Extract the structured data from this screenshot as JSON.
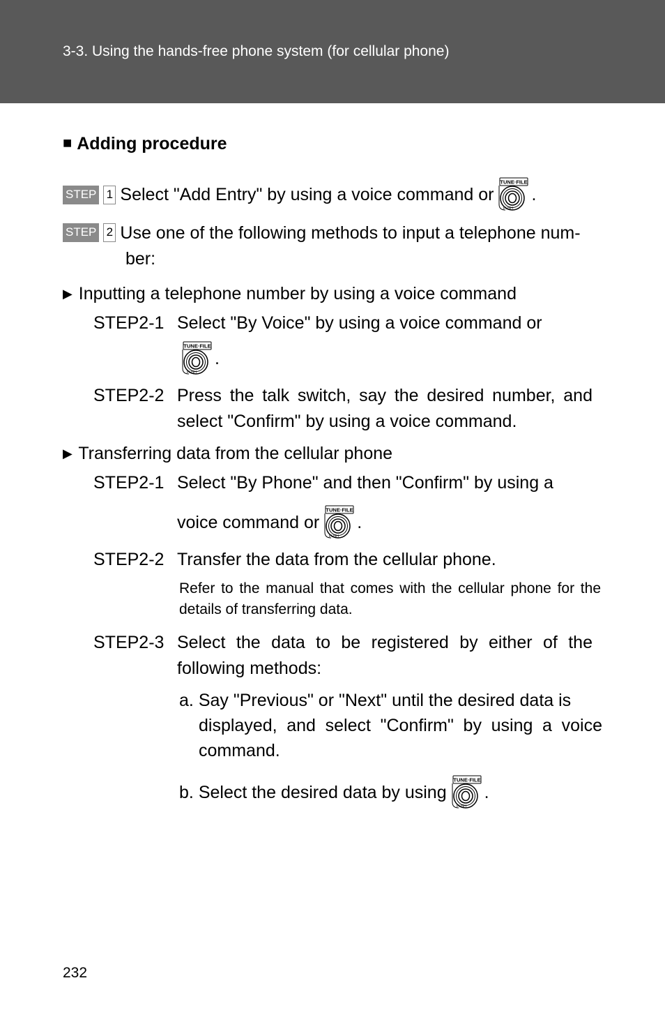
{
  "header": "3-3. Using the hands-free phone system (for cellular phone)",
  "heading_square": "■",
  "heading": "Adding procedure",
  "step_label": "STEP",
  "step1_num": "1",
  "step1_text_a": "Select \"Add Entry\" by using a voice command or ",
  "period": ".",
  "step2_num": "2",
  "step2_text": "Use one of the following methods to input a telephone number:",
  "arrow": "▶",
  "bullet_voice": "Inputting a telephone number by using a voice command",
  "s21v_lbl": "STEP2-1",
  "s21v_txt_a": "Select \"By Voice\" by using a voice command or",
  "s22v_lbl": "STEP2-2",
  "s22v_txt": "Press the talk switch, say the desired number, and select \"Confirm\" by using a voice command.",
  "bullet_phone": "Transferring data from the cellular phone",
  "s21p_lbl": "STEP2-1",
  "s21p_txt_a": "Select \"By Phone\" and then \"Confirm\" by using a",
  "s21p_txt_b": "voice command or ",
  "s22p_lbl": "STEP2-2",
  "s22p_txt": "Transfer the data from the cellular phone.",
  "s22p_note": "Refer to the manual that comes with the cellular phone for the details of transferring data.",
  "s23p_lbl": "STEP2-3",
  "s23p_txt": "Select the data to be registered by either of the following methods:",
  "a_label": "a.",
  "a_txt": "Say \"Previous\" or \"Next\" until the desired data is displayed, and select \"Confirm\" by using a voice command.",
  "b_label": "b.",
  "b_txt": "Select the desired data by using ",
  "page_num": "232"
}
